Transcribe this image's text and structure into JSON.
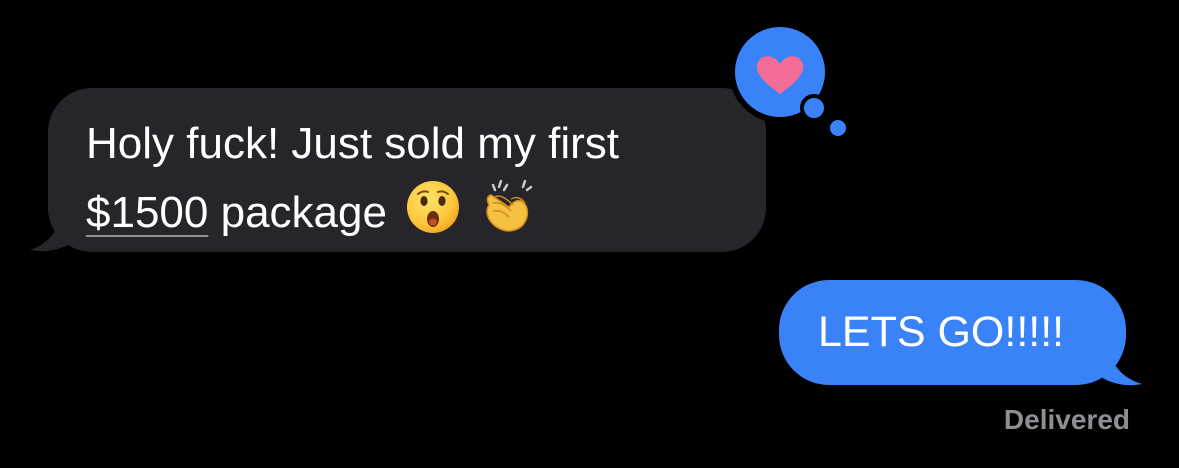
{
  "conversation": {
    "received_message": {
      "text_line1": "Holy fuck! Just sold my first",
      "amount": "$1500",
      "text_rest": "package",
      "emojis": [
        "astonished-face-emoji",
        "clapping-hands-emoji"
      ],
      "reaction": "heart"
    },
    "sent_message": {
      "text": "LETS GO!!!!!"
    },
    "status": "Delivered"
  },
  "colors": {
    "background": "#000000",
    "received_bubble": "#26252a",
    "sent_bubble": "#3a82f7",
    "tapback_bubble": "#3a82f7",
    "heart": "#f26d95",
    "status_text": "#8e8e93",
    "message_text": "#ffffff"
  }
}
